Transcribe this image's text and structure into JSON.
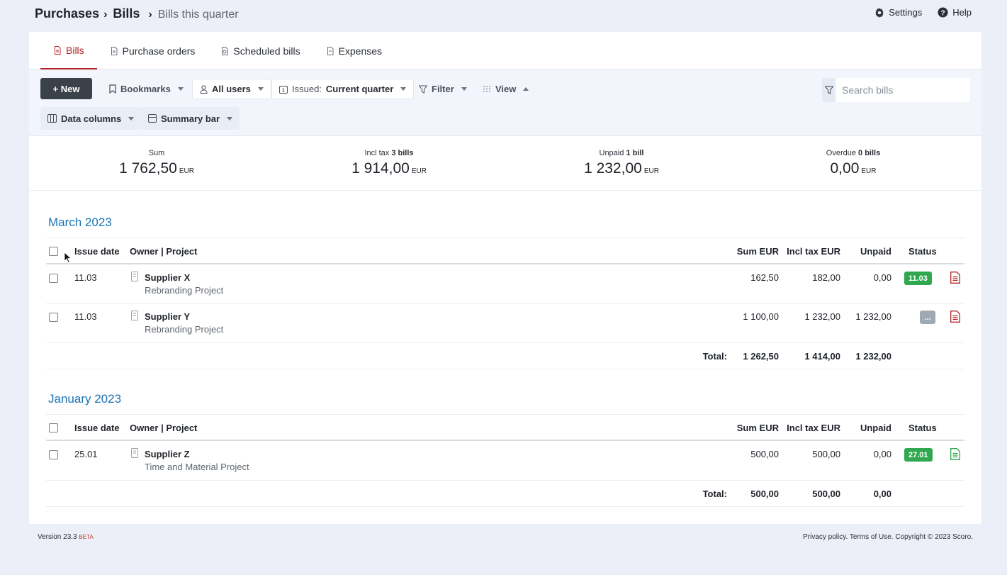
{
  "breadcrumb": {
    "level1": "Purchases",
    "level2": "Bills",
    "level3": "Bills this quarter"
  },
  "toplinks": {
    "settings": "Settings",
    "help": "Help"
  },
  "tabs": [
    {
      "label": "Bills",
      "active": true
    },
    {
      "label": "Purchase orders"
    },
    {
      "label": "Scheduled bills"
    },
    {
      "label": "Expenses"
    }
  ],
  "toolbar": {
    "new_label": "+ New",
    "bookmarks": "Bookmarks",
    "all_users": "All users",
    "issued_prefix": "Issued:",
    "issued_value": "Current quarter",
    "filter": "Filter",
    "view": "View",
    "data_columns": "Data columns",
    "summary_bar": "Summary bar",
    "search_placeholder": "Search bills"
  },
  "summary": [
    {
      "label": "Sum",
      "count": "",
      "value": "1 762,50",
      "currency": "EUR"
    },
    {
      "label": "Incl tax",
      "count": "3 bills",
      "value": "1 914,00",
      "currency": "EUR"
    },
    {
      "label": "Unpaid",
      "count": "1 bill",
      "value": "1 232,00",
      "currency": "EUR"
    },
    {
      "label": "Overdue",
      "count": "0 bills",
      "value": "0,00",
      "currency": "EUR"
    }
  ],
  "columns": {
    "issue_date": "Issue date",
    "owner_project": "Owner | Project",
    "sum": "Sum EUR",
    "incl_tax": "Incl tax EUR",
    "unpaid": "Unpaid",
    "status": "Status"
  },
  "groups": [
    {
      "month": "March 2023",
      "rows": [
        {
          "date": "11.03",
          "owner": "Supplier X",
          "project": "Rebranding Project",
          "sum": "162,50",
          "incl_tax": "182,00",
          "unpaid": "0,00",
          "status": "11.03",
          "status_type": "green",
          "doc_color": "#b3262b"
        },
        {
          "date": "11.03",
          "owner": "Supplier Y",
          "project": "Rebranding Project",
          "sum": "1 100,00",
          "incl_tax": "1 232,00",
          "unpaid": "1 232,00",
          "status": "...",
          "status_type": "gray",
          "doc_color": "#b3262b"
        }
      ],
      "total": {
        "label": "Total:",
        "sum": "1 262,50",
        "incl_tax": "1 414,00",
        "unpaid": "1 232,00"
      }
    },
    {
      "month": "January 2023",
      "rows": [
        {
          "date": "25.01",
          "owner": "Supplier Z",
          "project": "Time and Material Project",
          "sum": "500,00",
          "incl_tax": "500,00",
          "unpaid": "0,00",
          "status": "27.01",
          "status_type": "green",
          "doc_color": "#2fa84f"
        }
      ],
      "total": {
        "label": "Total:",
        "sum": "500,00",
        "incl_tax": "500,00",
        "unpaid": "0,00"
      }
    }
  ],
  "footer": {
    "version": "Version 23.3",
    "beta": "BETA",
    "legal": "Privacy policy. Terms of Use. Copyright © 2023 Scoro."
  }
}
